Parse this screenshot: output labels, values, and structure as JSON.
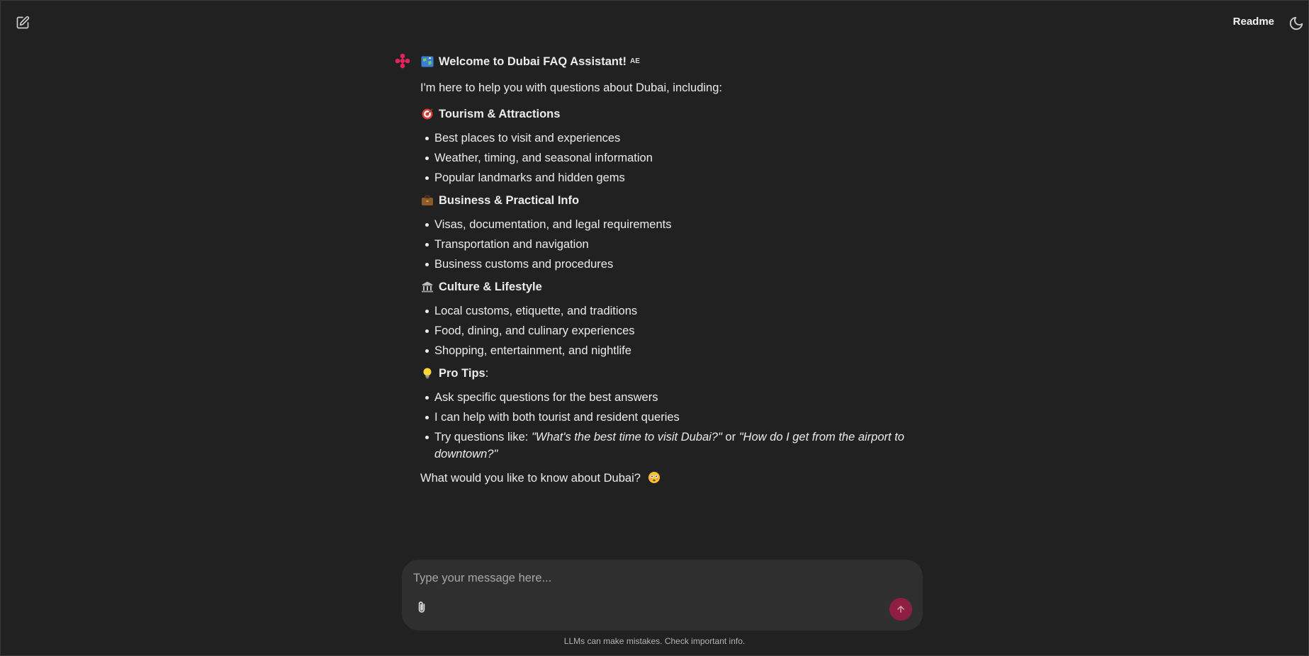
{
  "header": {
    "readme_label": "Readme"
  },
  "message": {
    "title": "Welcome to Dubai FAQ Assistant!",
    "title_badge": "AE",
    "intro": "I'm here to help you with questions about Dubai, including:",
    "sections": [
      {
        "icon": "target-icon",
        "title": "Tourism & Attractions",
        "items": [
          "Best places to visit and experiences",
          "Weather, timing, and seasonal information",
          "Popular landmarks and hidden gems"
        ]
      },
      {
        "icon": "briefcase-icon",
        "title": "Business & Practical Info",
        "items": [
          "Visas, documentation, and legal requirements",
          "Transportation and navigation",
          "Business customs and procedures"
        ]
      },
      {
        "icon": "classical-building-icon",
        "title": "Culture & Lifestyle",
        "items": [
          "Local customs, etiquette, and traditions",
          "Food, dining, and culinary experiences",
          "Shopping, entertainment, and nightlife"
        ]
      }
    ],
    "pro_tips": {
      "icon": "lightbulb-icon",
      "title": "Pro Tips",
      "suffix": ":",
      "items": [
        "Ask specific questions for the best answers",
        "I can help with both tourist and resident queries"
      ],
      "examples_prefix": "Try questions like: ",
      "example_1": "\"What's the best time to visit Dubai?\"",
      "examples_joiner": " or ",
      "example_2": "\"How do I get from the airport to downtown?\""
    },
    "closing": "What would you like to know about Dubai?"
  },
  "composer": {
    "placeholder": "Type your message here..."
  },
  "footer": {
    "disclaimer": "LLMs can make mistakes. Check important info."
  },
  "colors": {
    "background": "#212121",
    "composer": "#2f2f2f",
    "send_button": "#8e1f43",
    "brand_logo": "#e0245e"
  }
}
